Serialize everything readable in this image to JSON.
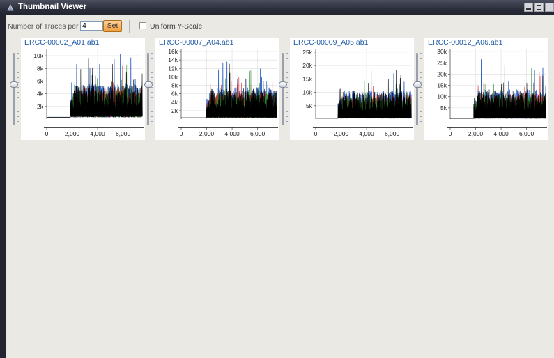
{
  "window": {
    "title": "Thumbnail Viewer"
  },
  "toolbar": {
    "traces_label": "Number of Traces per Row",
    "traces_value": "4",
    "set_label": "Set",
    "uniform_label": "Uniform Y-Scale",
    "uniform_checked": false
  },
  "colors": {
    "A": "#2e8b2e",
    "C": "#2f62c4",
    "G": "#000000",
    "T": "#e02020"
  },
  "chart_data": [
    {
      "type": "line",
      "title": "ERCC-00002_A01.ab1",
      "xticks": [
        "0",
        "2,000",
        "4,000",
        "6,000"
      ],
      "xlim": [
        0,
        7500
      ],
      "yticks": [
        "2k",
        "4k",
        "6k",
        "8k",
        "10k"
      ],
      "ylim": [
        0,
        11000
      ],
      "baseline": 300,
      "signal_start": 1850,
      "noise": 4500,
      "seed": 11
    },
    {
      "type": "line",
      "title": "ERCC-00007_A04.ab1",
      "xticks": [
        "0",
        "2,000",
        "4,000",
        "6,000"
      ],
      "xlim": [
        0,
        7500
      ],
      "yticks": [
        "2k",
        "4k",
        "6k",
        "8k",
        "10k",
        "12k",
        "14k",
        "16k"
      ],
      "ylim": [
        0,
        16500
      ],
      "baseline": 300,
      "signal_start": 1950,
      "noise": 6000,
      "seed": 22
    },
    {
      "type": "line",
      "title": "ERCC-00009_A05.ab1",
      "xticks": [
        "0",
        "2,000",
        "4,000",
        "6,000"
      ],
      "xlim": [
        0,
        7500
      ],
      "yticks": [
        "5k",
        "10k",
        "15k",
        "20k",
        "25k"
      ],
      "ylim": [
        0,
        26000
      ],
      "baseline": 300,
      "signal_start": 1750,
      "noise": 8500,
      "seed": 33
    },
    {
      "type": "line",
      "title": "ERCC-00012_A06.ab1",
      "xticks": [
        "0",
        "2,000",
        "4,000",
        "6,000"
      ],
      "xlim": [
        0,
        7500
      ],
      "yticks": [
        "5k",
        "10k",
        "15k",
        "20k",
        "25k",
        "30k"
      ],
      "ylim": [
        0,
        31000
      ],
      "baseline": 300,
      "signal_start": 1850,
      "noise": 10500,
      "seed": 44
    }
  ]
}
